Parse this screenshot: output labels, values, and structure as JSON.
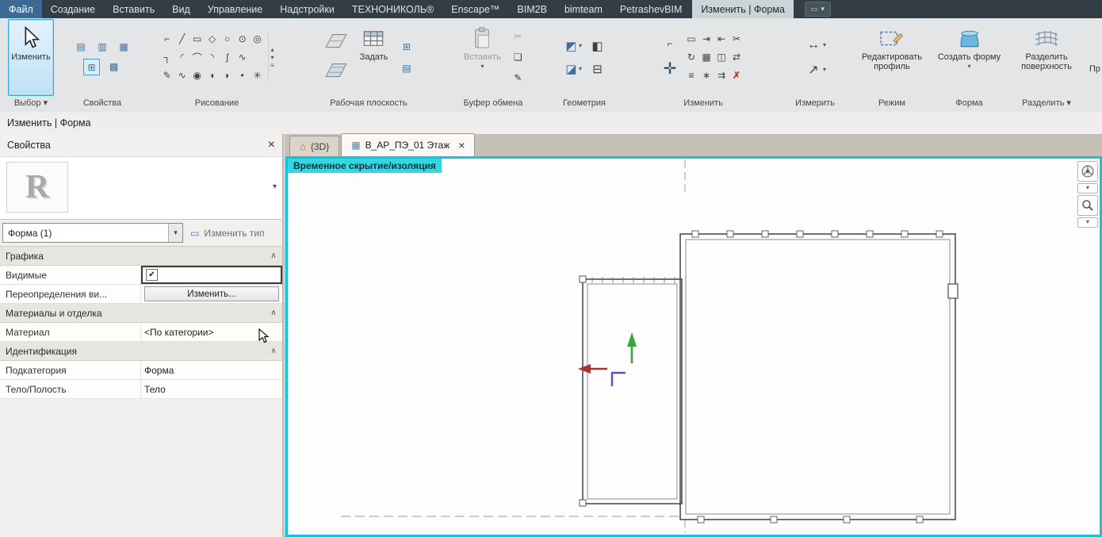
{
  "glyphs": {
    "down": "▾",
    "tri_up": "▴",
    "up": "∧",
    "close": "×",
    "check": "✔",
    "panel": "▭",
    "menu": "≡"
  },
  "colors": {
    "accent_cyan": "#16c2da",
    "selection_blue": "#38a5da",
    "delete_red": "#c0392b"
  },
  "menubar": {
    "tabs": [
      "Файл",
      "Создание",
      "Вставить",
      "Вид",
      "Управление",
      "Надстройки",
      "ТЕХНОНИКОЛЬ®",
      "Enscape™",
      "BIM2B",
      "bimteam",
      "PetrashevBIM"
    ],
    "context_tab": "Изменить | Форма"
  },
  "ribbon": {
    "select": {
      "label": "Выбор ▾",
      "modify": "Изменить"
    },
    "properties": {
      "label": "Свойства",
      "icons": [
        "▤",
        "▥",
        "▦",
        "⊞",
        "▩"
      ]
    },
    "draw": {
      "label": "Рисование",
      "row1": [
        "⌐",
        "╱",
        "▭",
        "◇",
        "○",
        "⊙",
        "◎"
      ],
      "row2": [
        "┐",
        "◜",
        "⌒",
        "◝",
        "ʃ",
        "∿"
      ],
      "row3": [
        "✎",
        "∿",
        "◉",
        "◖",
        "◗",
        "•",
        "✳"
      ]
    },
    "workplane": {
      "label": "Рабочая плоскость",
      "set": "Задать",
      "icons": [
        "⊞",
        "▤"
      ]
    },
    "clipboard": {
      "label": "Буфер обмена",
      "paste": "Вставить",
      "icons": [
        "✂",
        "❏",
        "✎"
      ]
    },
    "geometry": {
      "label": "Геометрия",
      "icons": [
        "◩",
        "◪",
        "◧",
        "⊟"
      ]
    },
    "modify": {
      "label": "Изменить",
      "move": "✛",
      "row1": [
        "⌐",
        "▭",
        "⇥",
        "⇤",
        "✂"
      ],
      "row2": [
        "↻",
        "▦",
        "◫",
        "⇄"
      ],
      "row3": [
        "≡",
        "∗",
        "⇉"
      ],
      "delete": "✗"
    },
    "measure": {
      "label": "Измерить",
      "icons": [
        "↔",
        "↗"
      ]
    },
    "mode": {
      "label": "Режим",
      "edit_profile": "Редактировать профиль"
    },
    "form": {
      "label": "Форма",
      "create_form": "Создать форму"
    },
    "divide": {
      "label": "Разделить ▾",
      "divide_surface": "Разделить поверхность"
    },
    "overflow": "Пр"
  },
  "options_bar": {
    "mode_label": "Изменить | Форма"
  },
  "properties_panel": {
    "title": "Свойства",
    "type_logo": "R",
    "filter_value": "Форма (1)",
    "edit_type": "Изменить тип",
    "rows": [
      {
        "label": "Графика"
      },
      {
        "label": "Видимые"
      },
      {
        "label": "Переопределения ви...",
        "value": "Изменить..."
      },
      {
        "label": "Материалы и отделка"
      },
      {
        "label": "Материал",
        "value": "<По категории>"
      },
      {
        "label": "Идентификация"
      },
      {
        "label": "Подкатегория",
        "value": "Форма"
      },
      {
        "label": "Тело/Полость",
        "value": "Тело"
      }
    ]
  },
  "canvas": {
    "tabs": [
      {
        "label": "{3D}"
      },
      {
        "label": "В_АР_ПЭ_01 Этаж"
      }
    ],
    "overlay": "Временное скрытие/изоляция"
  }
}
